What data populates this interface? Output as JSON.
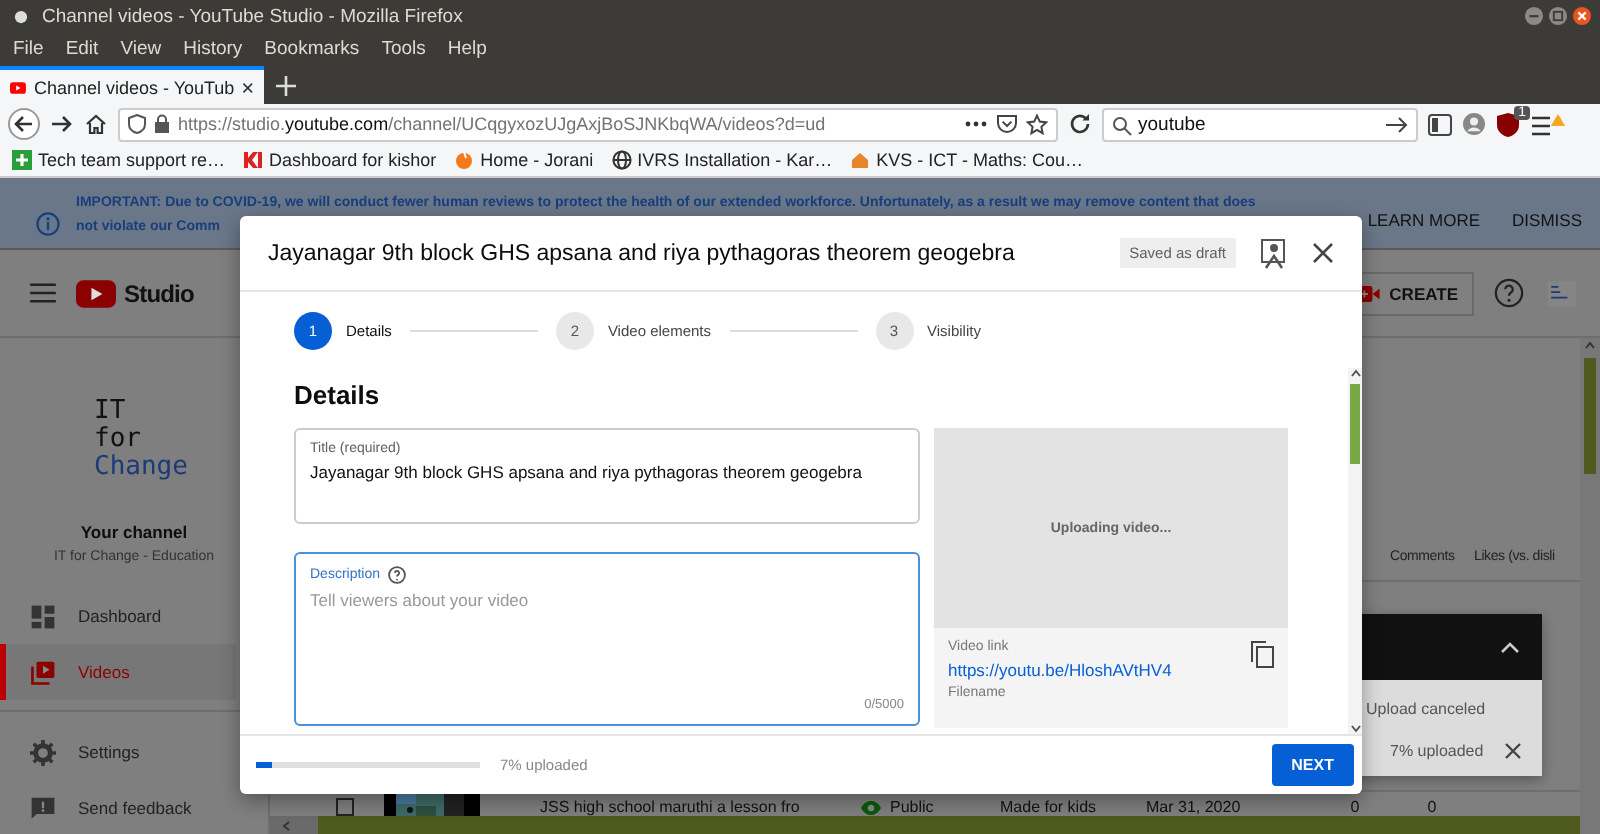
{
  "window": {
    "title": "Channel videos - YouTube Studio - Mozilla Firefox"
  },
  "menu": [
    "File",
    "Edit",
    "View",
    "History",
    "Bookmarks",
    "Tools",
    "Help"
  ],
  "tabs": [
    {
      "label": "Channel videos - YouTub",
      "selected": true
    }
  ],
  "address": {
    "url_start": "https://studio.",
    "url_host": "youtube.com",
    "url_rest": "/channel/UCqgyxozUJgAxjBoSJNKbqWA/videos?d=ud"
  },
  "search": {
    "value": "youtube"
  },
  "extension_badge": "1",
  "bookmarks": [
    "Tech team support re…",
    "Dashboard for kishor",
    "Home - Jorani",
    "IVRS Installation - Kar…",
    "KVS - ICT - Maths: Cou…"
  ],
  "banner": {
    "text": "IMPORTANT: Due to COVID-19, we will conduct fewer human reviews to protect the health of our extended workforce. Unfortunately, as a result we may remove content that does",
    "continuation": "not violate our Comm",
    "actions": [
      "LEARN MORE",
      "DISMISS"
    ]
  },
  "header": {
    "logo": "Studio",
    "create": "CREATE"
  },
  "channel": {
    "logo_lines": [
      "IT",
      "for",
      "Change"
    ],
    "name": "Your channel",
    "subtitle": "IT for Change - Education"
  },
  "nav": [
    {
      "label": "Dashboard",
      "selected": false
    },
    {
      "label": "Videos",
      "selected": true
    },
    {
      "label": "Settings",
      "selected": false
    },
    {
      "label": "Send feedback",
      "selected": false
    }
  ],
  "table": {
    "columns": [
      "Comments",
      "Likes (vs. disli"
    ],
    "rows": [
      {
        "checked": false,
        "title": "JSS high school maruthi a lesson fro",
        "visibility": "Public",
        "restrictions": "Made for kids",
        "date": "Mar 31, 2020",
        "column_7": "0",
        "comments": "0"
      }
    ]
  },
  "dialog": {
    "title": "Jayanagar 9th block GHS apsana and riya pythagoras theorem geogebra",
    "status": "Saved as draft",
    "steps": [
      {
        "number": "1",
        "label": "Details",
        "selected": true
      },
      {
        "number": "2",
        "label": "Video elements",
        "selected": false
      },
      {
        "number": "3",
        "label": "Visibility",
        "selected": false
      }
    ],
    "heading": "Details",
    "title_field": {
      "label": "Title (required)",
      "value": "Jayanagar 9th block GHS apsana and riya  pythagoras theorem geogebra"
    },
    "description_field": {
      "label": "Description",
      "placeholder": "Tell viewers about your video",
      "counter": "0/5000"
    },
    "preview": {
      "status": "Uploading video..."
    },
    "video_link": {
      "label": "Video link",
      "url": "https://youtu.be/HloshAVtHV4"
    },
    "filename_label": "Filename",
    "progress": {
      "level": 0.07,
      "text": "7% uploaded"
    },
    "next": "NEXT"
  },
  "toast": {
    "status": "Upload canceled",
    "progress": "7% uploaded"
  }
}
